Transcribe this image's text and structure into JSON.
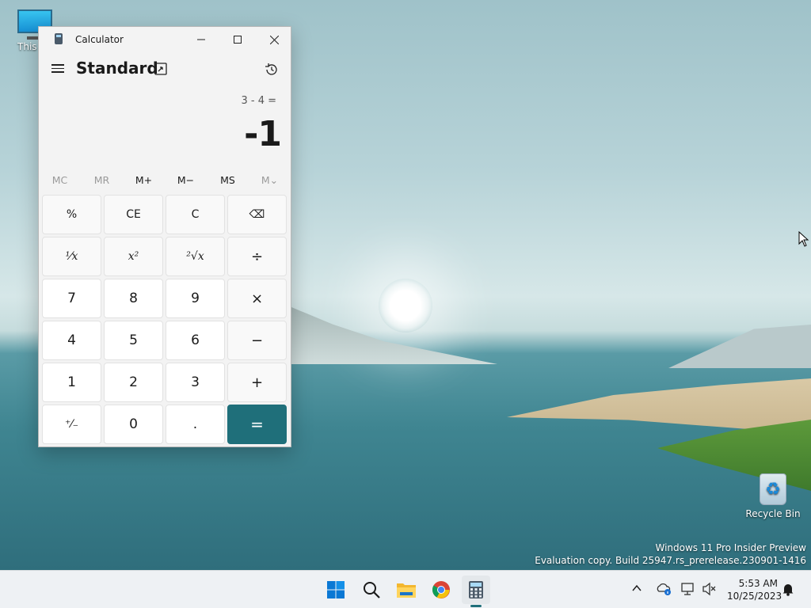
{
  "desktop": {
    "icons": [
      {
        "label": "This PC"
      },
      {
        "label": "Recycle Bin"
      }
    ],
    "watermark": {
      "line1": "Windows 11 Pro Insider Preview",
      "line2": "Evaluation copy. Build 25947.rs_prerelease.230901-1416"
    }
  },
  "calculator": {
    "title": "Calculator",
    "mode": "Standard",
    "expression": "3 - 4 =",
    "result": "-1",
    "memory": [
      {
        "label": "MC",
        "enabled": false
      },
      {
        "label": "MR",
        "enabled": false
      },
      {
        "label": "M+",
        "enabled": true
      },
      {
        "label": "M−",
        "enabled": true
      },
      {
        "label": "MS",
        "enabled": true
      },
      {
        "label": "M⌄",
        "enabled": false
      }
    ],
    "keys": {
      "percent": "%",
      "ce": "CE",
      "c": "C",
      "backspace": "⌫",
      "reciprocal": "¹⁄x",
      "square": "x²",
      "sqrt": "²√x",
      "divide": "÷",
      "seven": "7",
      "eight": "8",
      "nine": "9",
      "multiply": "×",
      "four": "4",
      "five": "5",
      "six": "6",
      "minus": "−",
      "one": "1",
      "two": "2",
      "three": "3",
      "plus": "+",
      "negate": "⁺⁄₋",
      "zero": "0",
      "decimal": ".",
      "equals": "="
    },
    "accent_color": "#1f6f7a"
  },
  "taskbar": {
    "apps": [
      "start-icon",
      "search-icon",
      "file-explorer-icon",
      "chrome-icon",
      "calculator-icon"
    ],
    "clock": {
      "time": "5:53 AM",
      "date": "10/25/2023"
    }
  }
}
